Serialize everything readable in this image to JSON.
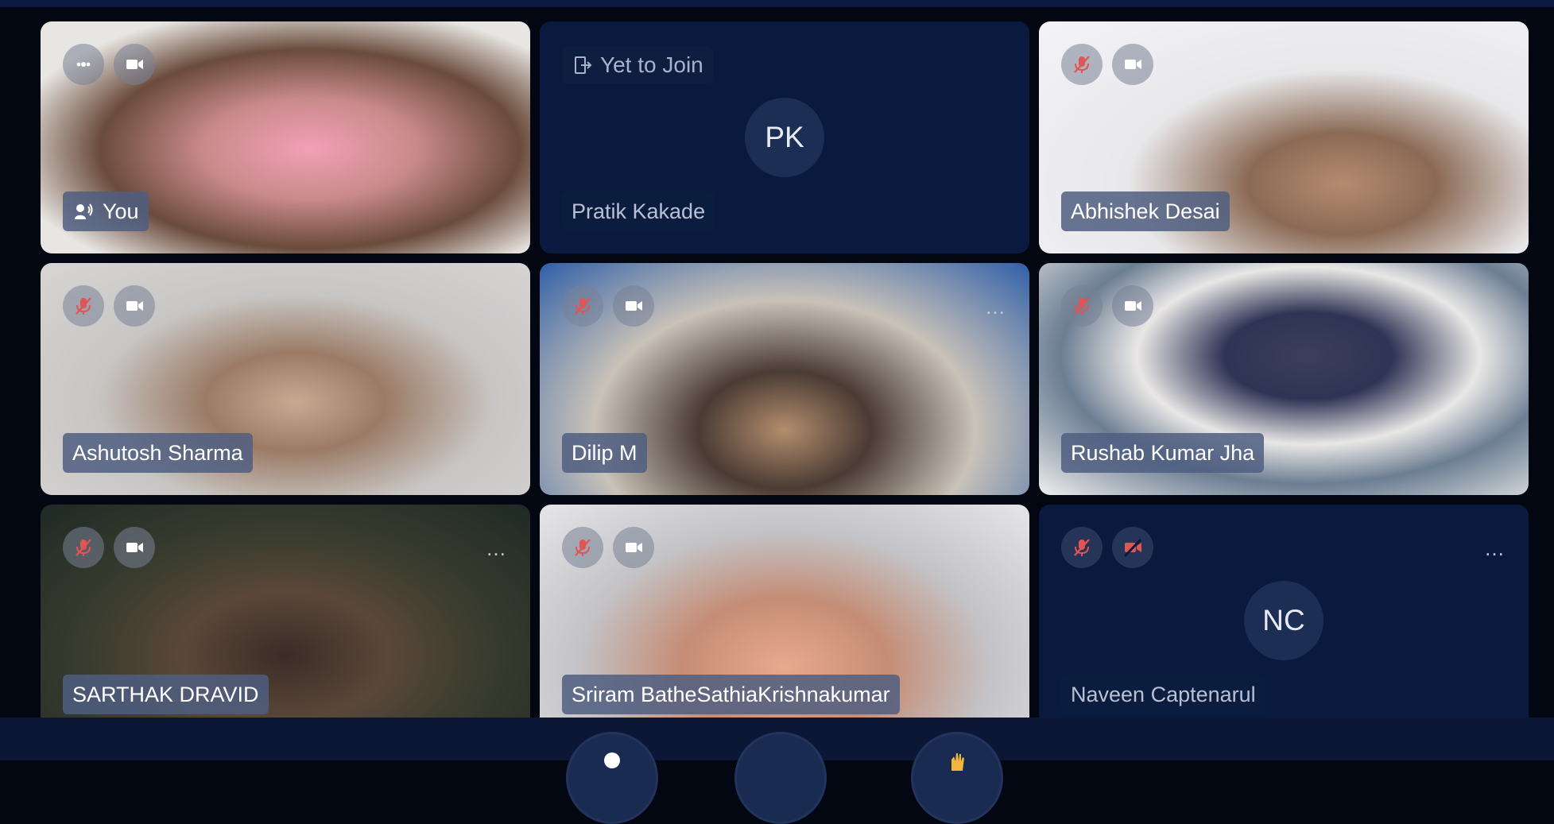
{
  "tiles": [
    {
      "name": "You",
      "type": "video",
      "mic": "speaking",
      "cam": "on",
      "menu": false
    },
    {
      "name": "Pratik Kakade",
      "type": "yet-to-join",
      "status": "Yet to Join",
      "initials": "PK"
    },
    {
      "name": "Abhishek Desai",
      "type": "video",
      "mic": "muted",
      "cam": "on",
      "menu": true
    },
    {
      "name": "Ashutosh Sharma",
      "type": "video",
      "mic": "muted",
      "cam": "on",
      "menu": true
    },
    {
      "name": "Dilip M",
      "type": "video",
      "mic": "muted",
      "cam": "on",
      "menu": true
    },
    {
      "name": "Rushab Kumar Jha",
      "type": "video",
      "mic": "muted",
      "cam": "on",
      "menu": true
    },
    {
      "name": "SARTHAK DRAVID",
      "type": "video",
      "mic": "muted",
      "cam": "on",
      "menu": true
    },
    {
      "name": "Sriram BatheSathiaKrishnakumar",
      "type": "video",
      "mic": "muted",
      "cam": "on",
      "menu": true
    },
    {
      "name": "Naveen Captenarul",
      "type": "avatar",
      "initials": "NC",
      "mic": "muted",
      "cam": "off",
      "menu": true
    }
  ],
  "more_glyph": "…",
  "icons": {
    "mic_speaking": "more-dots-icon",
    "mic_muted": "mic-muted-icon",
    "cam_on": "camera-icon",
    "cam_off": "camera-off-icon",
    "join": "door-exit-icon",
    "speaker": "speaker-icon"
  },
  "colors": {
    "background": "#030711",
    "tile": "#0a1a3e",
    "muted_red": "#e05555",
    "name_tag": "#4f5e80"
  }
}
